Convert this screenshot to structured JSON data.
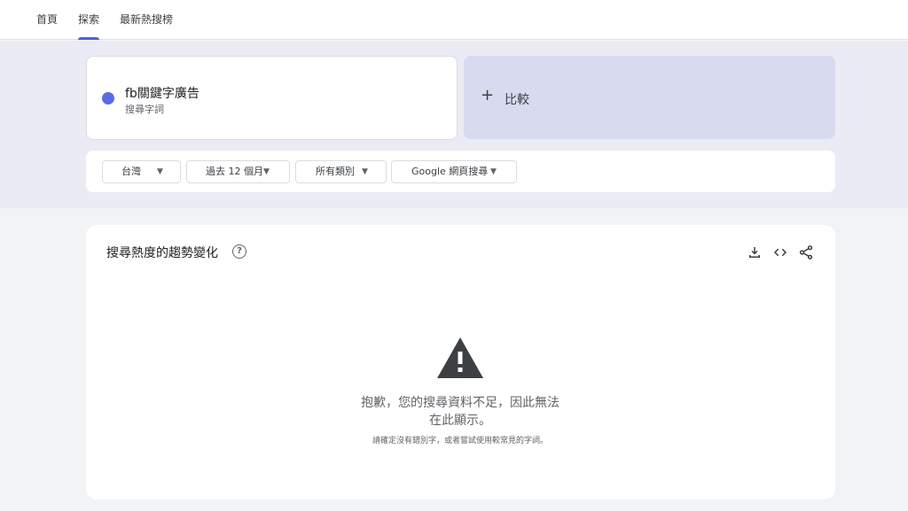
{
  "nav": {
    "tabs": [
      {
        "label": "首頁"
      },
      {
        "label": "探索"
      },
      {
        "label": "最新熱搜榜"
      }
    ],
    "active_tab": "探索"
  },
  "term": {
    "name": "fb關鍵字廣告",
    "subtitle": "搜尋字詞",
    "color": "#5b6be8"
  },
  "compare": {
    "plus": "+",
    "label": "比較"
  },
  "filters": [
    {
      "value": "台灣"
    },
    {
      "value": "過去 12 個月"
    },
    {
      "value": "所有類別"
    },
    {
      "value": "Google 網頁搜尋"
    }
  ],
  "chart_section": {
    "title": "搜尋熱度的趨勢變化",
    "help_icon": "?",
    "actions": [
      "download-icon",
      "embed-code-icon",
      "share-icon"
    ]
  },
  "error": {
    "icon": "warning-icon",
    "message_line1": "抱歉，您的搜尋資料不足，因此無法",
    "message_line2": "在此顯示。",
    "hint": "請確定沒有錯別字，或者嘗試使用較常見的字詞。"
  },
  "colors": {
    "accent": "#4b5ed6",
    "band": "#ebebf5",
    "compare_bg": "#d8daf0"
  }
}
